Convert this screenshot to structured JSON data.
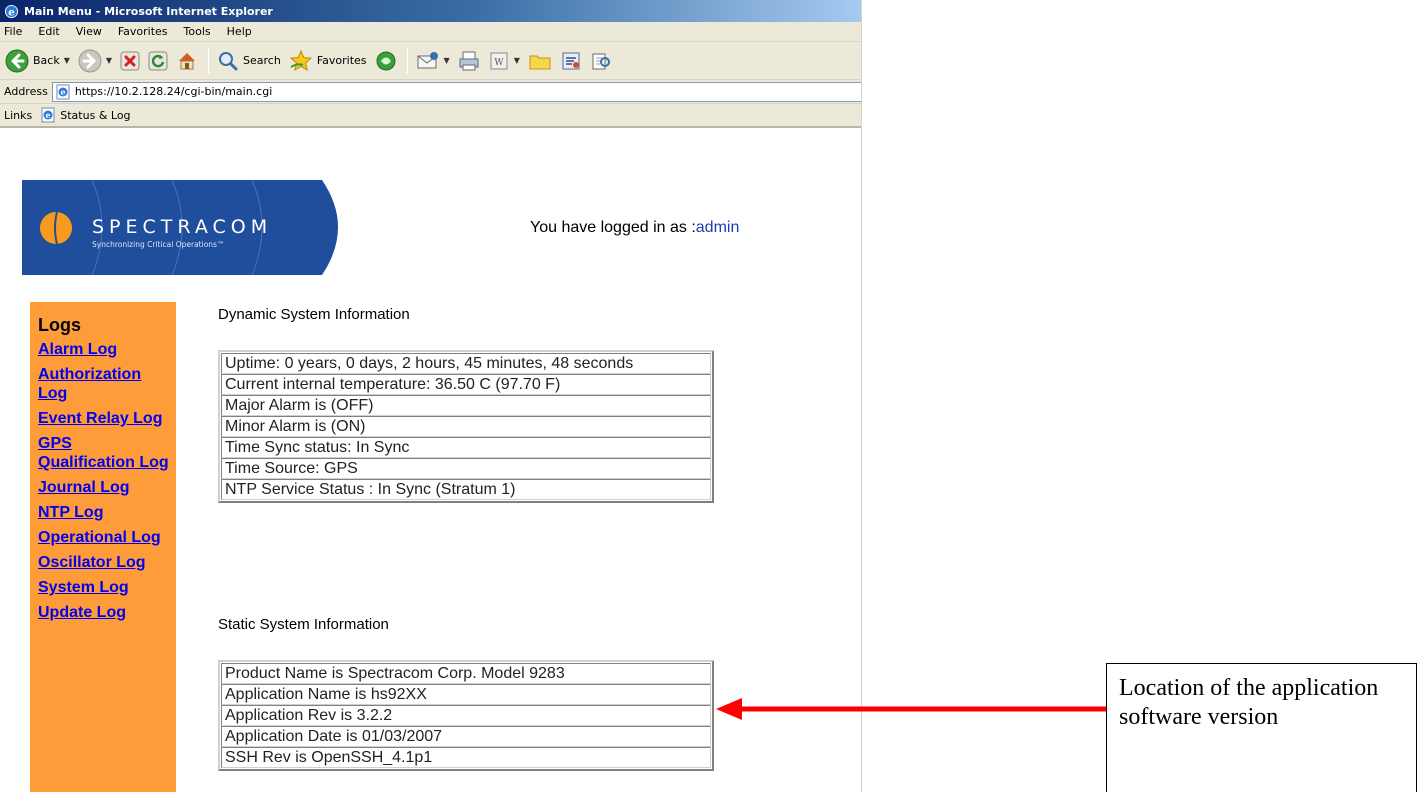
{
  "window": {
    "title": "Main Menu - Microsoft Internet Explorer"
  },
  "menubar": {
    "items": [
      "File",
      "Edit",
      "View",
      "Favorites",
      "Tools",
      "Help"
    ]
  },
  "toolbar": {
    "back_label": "Back",
    "search_label": "Search",
    "favorites_label": "Favorites"
  },
  "addressbar": {
    "label": "Address",
    "url": "https://10.2.128.24/cgi-bin/main.cgi"
  },
  "linksbar": {
    "label": "Links",
    "items": [
      "Status & Log"
    ]
  },
  "brand": {
    "name": "SPECTRACOM",
    "tagline": "Synchronizing Critical Operations™",
    "color": "#1f4e9c"
  },
  "login": {
    "prefix": "You have logged in as :",
    "user": "admin"
  },
  "sidebar": {
    "title": "Logs",
    "background": "#ff9c3a",
    "links": [
      "Alarm Log",
      "Authorization Log",
      "Event Relay Log",
      "GPS Qualification Log",
      "Journal Log",
      "NTP Log",
      "Operational Log",
      "Oscillator Log",
      "System Log",
      "Update Log"
    ]
  },
  "dynamic_info": {
    "title": "Dynamic System Information",
    "rows": [
      "Uptime: 0 years, 0 days, 2 hours, 45 minutes, 48 seconds",
      "Current internal temperature: 36.50 C (97.70 F)",
      "Major Alarm is (OFF)",
      "Minor Alarm is (ON)",
      "Time Sync status: In Sync",
      "Time Source: GPS",
      "NTP Service Status : In Sync (Stratum 1)"
    ]
  },
  "static_info": {
    "title": "Static System Information",
    "rows": [
      "Product Name is Spectracom Corp. Model 9283",
      "Application Name is hs92XX",
      "Application Rev is 3.2.2",
      "Application Date is 01/03/2007",
      "SSH Rev is OpenSSH_4.1p1"
    ]
  },
  "annotation": {
    "text": "Location of the application software version",
    "arrow_color": "#ff0000"
  }
}
